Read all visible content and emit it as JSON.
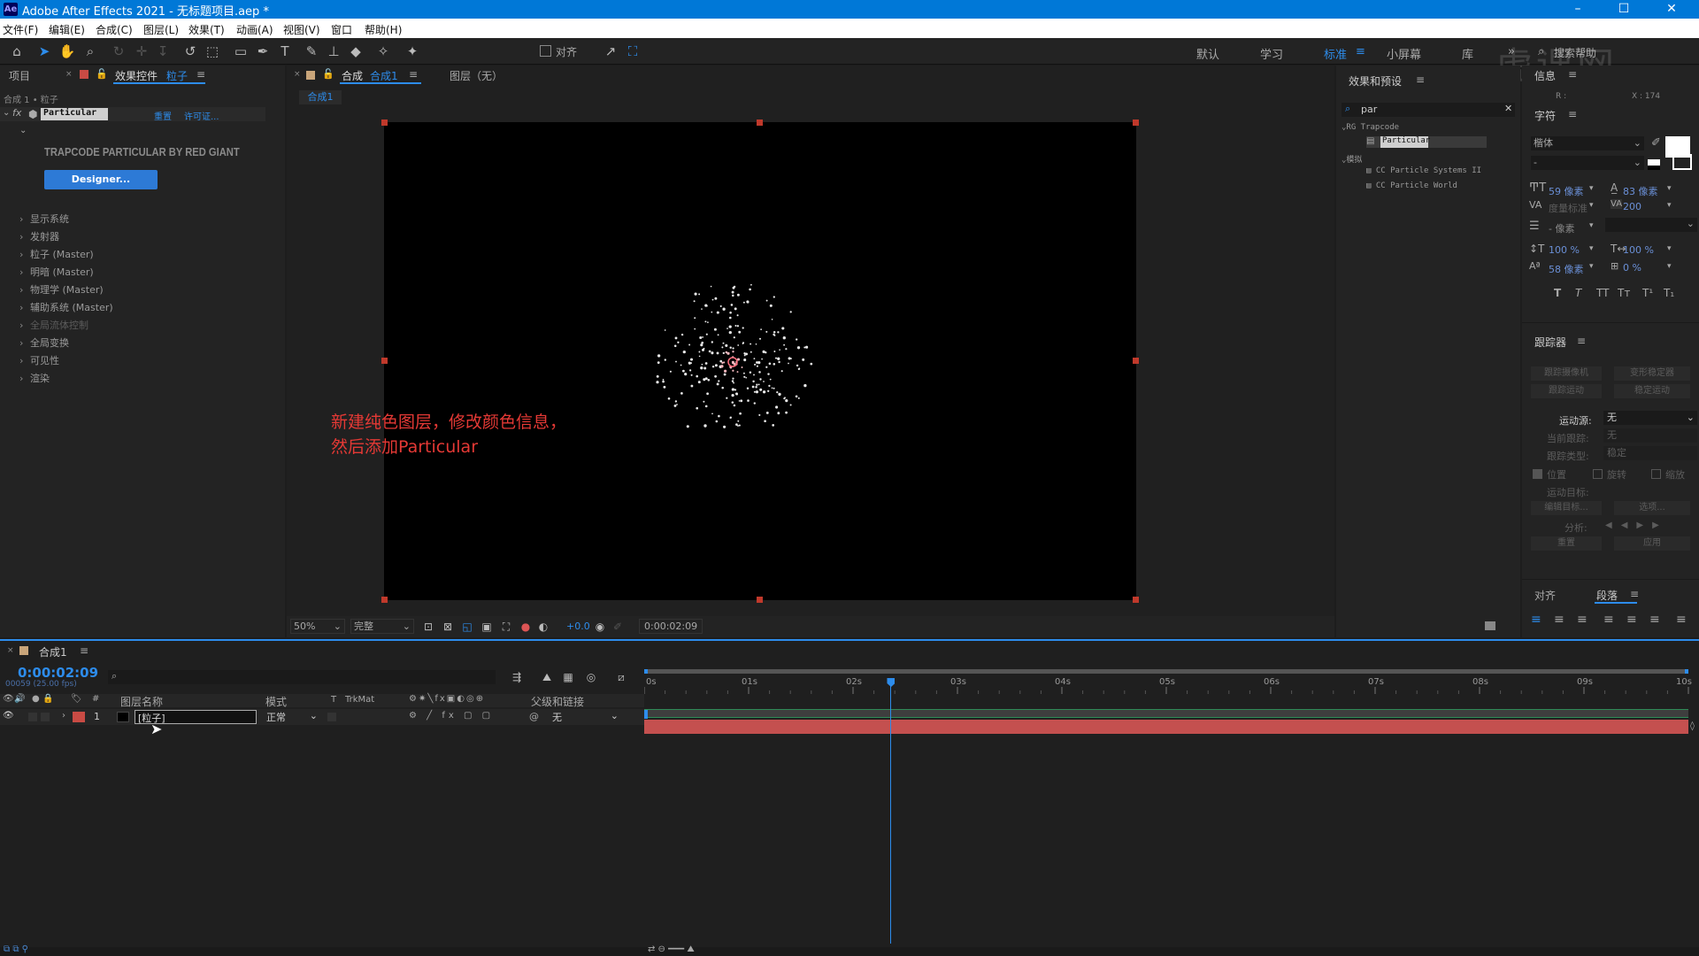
{
  "window": {
    "app_icon": "Ae",
    "title": "Adobe After Effects 2021 - 无标题项目.aep *",
    "min": "–",
    "max": "☐",
    "close": "✕"
  },
  "menu": [
    "文件(F)",
    "编辑(E)",
    "合成(C)",
    "图层(L)",
    "效果(T)",
    "动画(A)",
    "视图(V)",
    "窗口",
    "帮助(H)"
  ],
  "toolbar": {
    "align_label": "对齐",
    "workspaces": [
      "默认",
      "学习",
      "标准",
      "小屏幕",
      "库"
    ],
    "active_workspace": "标准",
    "search_help": "搜索帮助",
    "watermark": "虎课网"
  },
  "left_panel": {
    "tab_project": "项目",
    "tab_effects": "效果控件",
    "tab_effects_layer": "粒子",
    "breadcrumb": "合成 1 • 粒子",
    "fx_label": "fx",
    "effect_name": "Particular",
    "reset": "重置",
    "license": "许可证...",
    "brand": "TRAPCODE PARTICULAR BY RED GIANT",
    "designer_button": "Designer...",
    "groups": [
      "显示系统",
      "发射器",
      "粒子 (Master)",
      "明暗 (Master)",
      "物理学 (Master)",
      "辅助系统 (Master)",
      "全局流体控制",
      "全局变换",
      "可见性",
      "渲染"
    ]
  },
  "comp_panel": {
    "tab_comp_prefix": "合成",
    "tab_comp_name": "合成1",
    "tab_layer": "图层（无）",
    "comp_chip": "合成1",
    "annotation_line1": "新建纯色图层，修改颜色信息，",
    "annotation_line2": "然后添加Particular",
    "zoom": "50%",
    "resolution": "完整",
    "exposure": "+0.0",
    "timecode": "0:00:02:09"
  },
  "effects_presets": {
    "title": "效果和预设",
    "search_value": "par",
    "tree": [
      {
        "label": "RG Trapcode",
        "level": 0
      },
      {
        "label": "Particular",
        "level": 1,
        "selected": true
      },
      {
        "label": "模拟",
        "level": 0
      },
      {
        "label": "CC Particle Systems II",
        "level": 1
      },
      {
        "label": "CC Particle World",
        "level": 1
      }
    ]
  },
  "info_panel": {
    "title": "信息",
    "r_label": "R :",
    "x_label": "X : 174"
  },
  "character_panel": {
    "title": "字符",
    "font": "楷体",
    "style": "-",
    "size": "59 像素",
    "leading": "83 像素",
    "kerning": "度量标准",
    "tracking": "200",
    "stroke": "- 像素",
    "vscale": "100 %",
    "hscale": "100 %",
    "baseline": "58 像素",
    "tsume": "0 %",
    "styles": [
      "T",
      "T",
      "TT",
      "Tт",
      "T¹",
      "T₁"
    ]
  },
  "tracker_panel": {
    "title": "跟踪器",
    "btn_track_camera": "跟踪摄像机",
    "btn_warp_stabilizer": "变形稳定器",
    "btn_track_motion": "跟踪运动",
    "btn_stabilize_motion": "稳定运动",
    "motion_source_label": "运动源:",
    "motion_source_value": "无",
    "current_track_label": "当前跟踪:",
    "current_track_value": "无",
    "track_type_label": "跟踪类型:",
    "track_type_value": "稳定",
    "cb_position": "位置",
    "cb_rotation": "旋转",
    "cb_scale": "缩放",
    "motion_target": "运动目标:",
    "edit_target": "编辑目标...",
    "options": "选项...",
    "analyze": "分析:",
    "reset": "重置",
    "apply": "应用"
  },
  "align_panel": {
    "tab_align": "对齐",
    "tab_paragraph": "段落"
  },
  "timeline": {
    "tab": "合成1",
    "timecode": "0:00:02:09",
    "frame_info": "00059 (25.00 fps)",
    "col_layer_name": "图层名称",
    "col_mode": "模式",
    "col_t": "T",
    "col_trkmat": "TrkMat",
    "col_parent": "父级和链接",
    "layer_index": "1",
    "layer_name": "[粒子]",
    "layer_mode": "正常",
    "layer_parent": "无",
    "ruler": [
      "0s",
      "01s",
      "02s",
      "03s",
      "04s",
      "05s",
      "06s",
      "07s",
      "08s",
      "09s",
      "10s"
    ],
    "playhead_seconds": 2.36,
    "duration_seconds": 10
  },
  "colors": {
    "accent": "#2d8ceb",
    "layer_bar": "#c4504f",
    "layer_label": "#c94b44",
    "annotation": "#e53935",
    "titlebar": "#0078d7"
  }
}
